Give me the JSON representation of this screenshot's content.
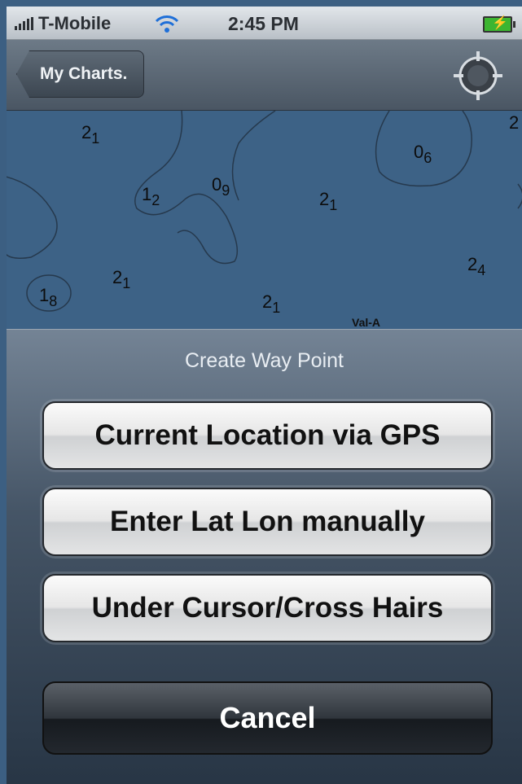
{
  "status_bar": {
    "carrier": "T-Mobile",
    "time": "2:45 PM"
  },
  "nav": {
    "back_label": "My Charts."
  },
  "map": {
    "depths": [
      {
        "main": "2",
        "sub": "1"
      },
      {
        "main": "1",
        "sub": "2"
      },
      {
        "main": "0",
        "sub": "9"
      },
      {
        "main": "2",
        "sub": "1"
      },
      {
        "main": "0",
        "sub": "6"
      },
      {
        "main": "2",
        "sub": ""
      },
      {
        "main": "2",
        "sub": "4"
      },
      {
        "main": "2",
        "sub": "1"
      },
      {
        "main": "1",
        "sub": "8"
      },
      {
        "main": "2",
        "sub": "1"
      }
    ],
    "marker_label": "Val-A"
  },
  "action_sheet": {
    "title": "Create Way Point",
    "buttons": [
      "Current Location via GPS",
      "Enter Lat Lon manually",
      "Under Cursor/Cross Hairs"
    ],
    "cancel_label": "Cancel"
  }
}
